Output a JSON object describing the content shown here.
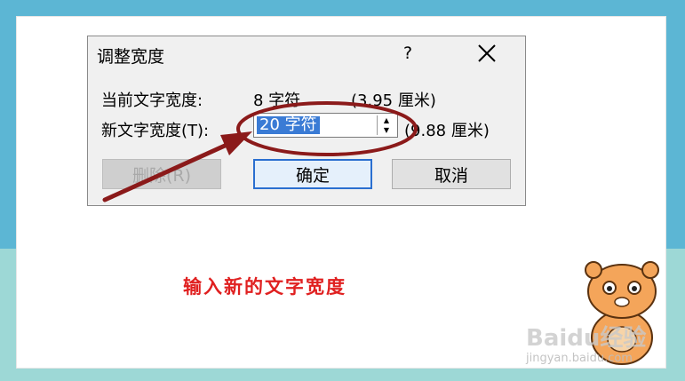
{
  "dialog": {
    "title": "调整宽度",
    "help": "?",
    "current_label": "当前文字宽度:",
    "current_chars": "8 字符",
    "current_cm": "(3.95 厘米)",
    "new_label": "新文字宽度(T):",
    "new_value": "20 字符",
    "new_cm": "(9.88 厘米)",
    "delete_button": "删除(R)",
    "ok_button": "确定",
    "cancel_button": "取消"
  },
  "annotation": {
    "instruction": "输入新的文字宽度",
    "highlight_color": "#8b1a1a",
    "text_color": "#e02020"
  },
  "watermark": {
    "brand": "Baidu经验",
    "url": "jingyan.baidu.com"
  },
  "colors": {
    "background_top": "#5cb6d4",
    "background_bottom": "#9dd8d6",
    "selection": "#3a7bd5"
  }
}
